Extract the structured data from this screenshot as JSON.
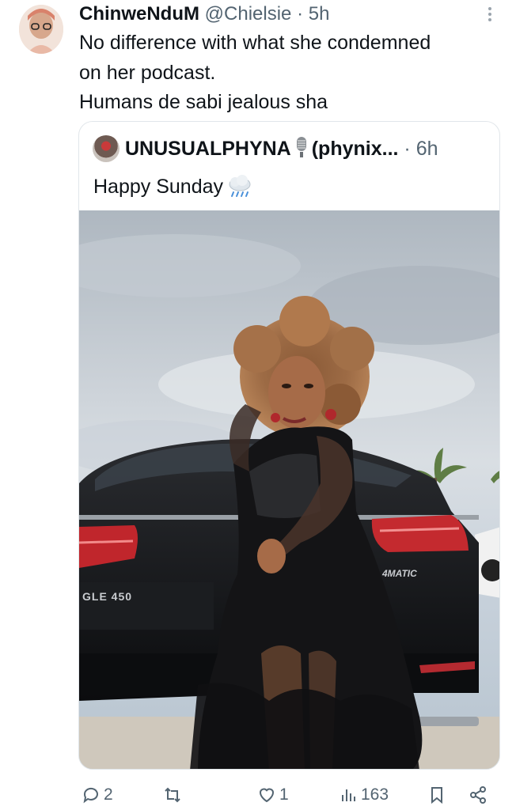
{
  "tweet": {
    "author_name": "ChinweNduM",
    "handle": "@Chielsie",
    "separator": "·",
    "time": "5h",
    "text_lines": [
      "No difference with what she condemned",
      "on her podcast.",
      "Humans de sabi jealous sha"
    ]
  },
  "quoted": {
    "author_name": "UNUSUALPHYNA",
    "handle": "(phynix...",
    "separator": "·",
    "time": "6h",
    "text": "Happy Sunday",
    "emoji_icon": "cloud-rain-icon",
    "photo_plate_text": "GLE 450",
    "photo_badge_text": "4MATIC"
  },
  "actions": {
    "replies": "2",
    "retweets": "",
    "likes": "1",
    "views": "163"
  },
  "colors": {
    "text": "#0f1419",
    "secondary": "#536471",
    "border": "#e1e6ea"
  }
}
